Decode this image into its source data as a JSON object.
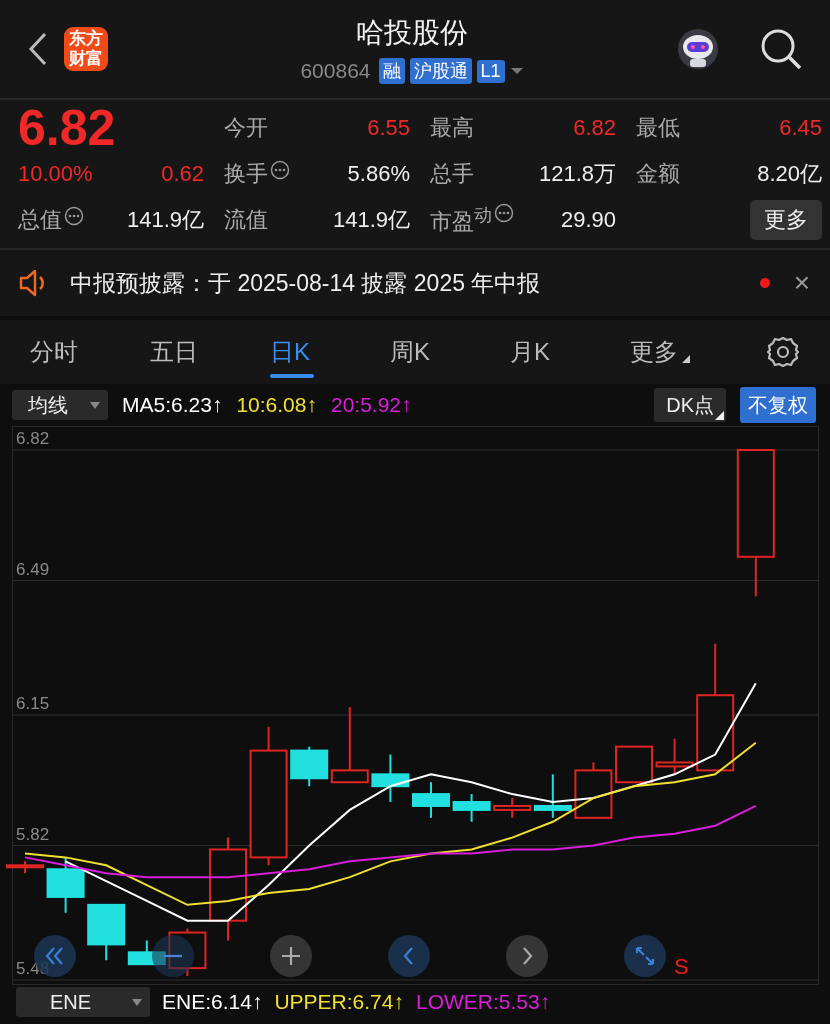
{
  "header": {
    "logo": "东方财富",
    "title": "哈投股份",
    "code": "600864",
    "badges": [
      "融",
      "沪股通",
      "L1"
    ]
  },
  "quote": {
    "price": "6.82",
    "change_pct": "10.00%",
    "change": "0.62",
    "rising": true,
    "stats": [
      {
        "label": "今开",
        "value": "6.55",
        "rising": true,
        "info": false
      },
      {
        "label": "最高",
        "value": "6.82",
        "rising": true,
        "info": false
      },
      {
        "label": "最低",
        "value": "6.45",
        "rising": true,
        "info": false
      },
      {
        "label": "换手",
        "value": "5.86%",
        "rising": false,
        "info": true
      },
      {
        "label": "总手",
        "value": "121.8万",
        "rising": false,
        "info": false
      },
      {
        "label": "金额",
        "value": "8.20亿",
        "rising": false,
        "info": false
      },
      {
        "label": "总值",
        "value": "141.9亿",
        "rising": false,
        "info": true
      },
      {
        "label": "流值",
        "value": "141.9亿",
        "rising": false,
        "info": false
      },
      {
        "label": "市盈$^{动}$",
        "value": "29.90",
        "rising": false,
        "info": true
      }
    ],
    "more_button": "更多"
  },
  "notice": {
    "text": "中报预披露：于 2025-08-14 披露 2025 年中报",
    "unread": true,
    "close": "×"
  },
  "tabs": [
    {
      "label": "分时",
      "selected": false,
      "menu": false
    },
    {
      "label": "五日",
      "selected": false,
      "menu": false
    },
    {
      "label": "日K",
      "selected": true,
      "menu": false
    },
    {
      "label": "周K",
      "selected": false,
      "menu": false
    },
    {
      "label": "月K",
      "selected": false,
      "menu": false
    },
    {
      "label": "更多",
      "selected": false,
      "menu": true
    }
  ],
  "indicator_bar": {
    "dropdown": "均线",
    "legend": [
      {
        "text": "MA5:6.23↑",
        "color": "#ffffff"
      },
      {
        "text": "10:6.08↑",
        "color": "#f0e030"
      },
      {
        "text": "20:5.92↑",
        "color": "#d81ed8"
      }
    ],
    "dk_button": "DK点",
    "adjust_button": "不复权"
  },
  "chart": {
    "marker": "S",
    "chart_data": {
      "type": "line",
      "ylim": [
        5.48,
        6.82
      ],
      "yticks": [
        6.82,
        6.49,
        6.15,
        5.82,
        5.48
      ],
      "grid": true,
      "series": [
        {
          "color": "#ffffff",
          "values": [
            null,
            5.78,
            5.73,
            5.68,
            5.63,
            5.63,
            5.72,
            5.82,
            5.91,
            5.97,
            6.0,
            5.98,
            5.95,
            5.93,
            5.94,
            5.97,
            6.0,
            6.05,
            6.23
          ]
        },
        {
          "color": "#f0e030",
          "values": [
            5.8,
            5.79,
            5.77,
            5.72,
            5.67,
            5.68,
            5.7,
            5.71,
            5.74,
            5.78,
            5.8,
            5.81,
            5.84,
            5.88,
            5.94,
            5.97,
            5.98,
            6.0,
            6.08
          ]
        },
        {
          "color": "#d81ed8",
          "values": [
            5.79,
            5.77,
            5.75,
            5.74,
            5.74,
            5.74,
            5.75,
            5.76,
            5.78,
            5.79,
            5.8,
            5.8,
            5.81,
            5.81,
            5.82,
            5.84,
            5.85,
            5.87,
            5.92
          ]
        }
      ]
    }
  },
  "bottom_bar": {
    "dropdown": "ENE",
    "legend": [
      {
        "text": "ENE:6.14↑",
        "color": "#ffffff"
      },
      {
        "text": "UPPER:6.74↑",
        "color": "#f0e030"
      },
      {
        "text": "LOWER:5.53↑",
        "color": "#d81ed8"
      }
    ]
  }
}
